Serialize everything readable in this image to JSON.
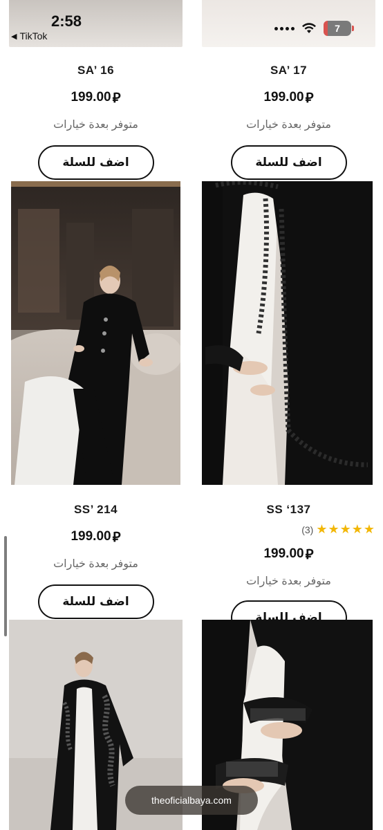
{
  "status_bar": {
    "time": "2:58",
    "back_app": "TikTok",
    "back_arrow": "◀",
    "battery_level": "7",
    "wifi_icon": "wifi-icon",
    "signal_icon": "signal-dots-icon"
  },
  "currency_symbol": "⃁",
  "products": [
    {
      "sku": "SA’ 16",
      "price": "199.00",
      "options_text": "متوفر بعدة خيارات",
      "button_label": "اضف للسلة"
    },
    {
      "sku": "SA’ 17",
      "price": "199.00",
      "options_text": "متوفر بعدة خيارات",
      "button_label": "اضف للسلة"
    },
    {
      "sku": "SS’ 214",
      "price": "199.00",
      "options_text": "متوفر بعدة خيارات",
      "button_label": "اضف للسلة"
    },
    {
      "sku": "SS ‘137",
      "rating_stars": "★★★★★",
      "rating_count": "(3)",
      "price": "199.00",
      "options_text": "متوفر بعدة خيارات",
      "button_label": "اضف للسلة"
    }
  ],
  "url_pill": "theoficialbaya.com",
  "colors": {
    "accent": "#111111",
    "star": "#f2b707",
    "muted_text": "#666666"
  }
}
